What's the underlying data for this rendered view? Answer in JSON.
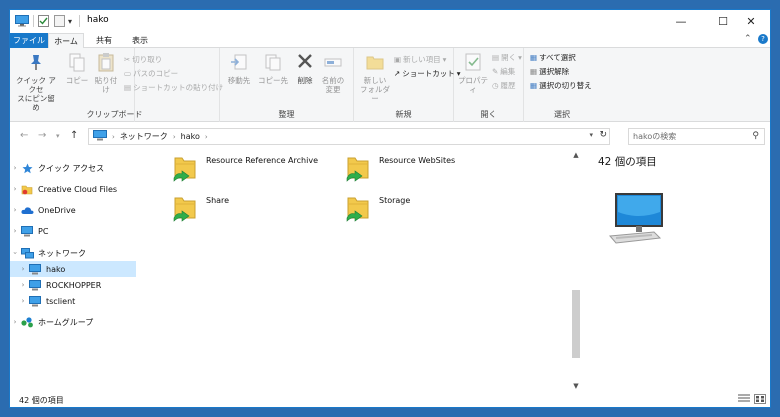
{
  "window": {
    "title": "hako",
    "controls": {
      "minimize": "—",
      "maximize": "☐",
      "close": "✕"
    }
  },
  "ribbon_tabs": {
    "file": "ファイル",
    "home": "ホーム",
    "share": "共有",
    "view": "表示"
  },
  "ribbon": {
    "clipboard": {
      "label": "クリップボード",
      "pin_line1": "クイック アクセ",
      "pin_line2": "スにピン留め",
      "copy": "コピー",
      "paste": "貼り付け",
      "cut": "切り取り",
      "copy_path": "パスのコピー",
      "paste_shortcut": "ショートカットの貼り付け"
    },
    "organize": {
      "label": "整理",
      "move_to": "移動先",
      "copy_to": "コピー先",
      "delete": "削除",
      "rename_line1": "名前の",
      "rename_line2": "変更"
    },
    "new": {
      "label": "新規",
      "new_folder_line1": "新しい",
      "new_folder_line2": "フォルダー",
      "new_item": "新しい項目",
      "shortcut": "ショートカット"
    },
    "open": {
      "label": "開く",
      "properties": "プロパティ",
      "open": "開く",
      "edit": "編集",
      "history": "履歴"
    },
    "select": {
      "label": "選択",
      "select_all": "すべて選択",
      "select_none": "選択解除",
      "invert": "選択の切り替え"
    }
  },
  "address": {
    "path": [
      "ネットワーク",
      "hako"
    ],
    "search_placeholder": "hakoの検索"
  },
  "nav_pane": {
    "quick_access": "クイック アクセス",
    "creative_cloud": "Creative Cloud Files",
    "onedrive": "OneDrive",
    "pc": "PC",
    "network": "ネットワーク",
    "hako": "hako",
    "rockhopper": "ROCKHOPPER",
    "tsclient": "tsclient",
    "homegroup": "ホームグループ"
  },
  "files": [
    {
      "name": "Resource Reference Archive"
    },
    {
      "name": "Resource WebSites"
    },
    {
      "name": "Share"
    },
    {
      "name": "Storage"
    }
  ],
  "details": {
    "count": "42 個の項目"
  },
  "status": {
    "text": "42 個の項目"
  },
  "colors": {
    "accent": "#1979ca",
    "selected": "#cce8ff",
    "folder": "#f2c94c"
  }
}
